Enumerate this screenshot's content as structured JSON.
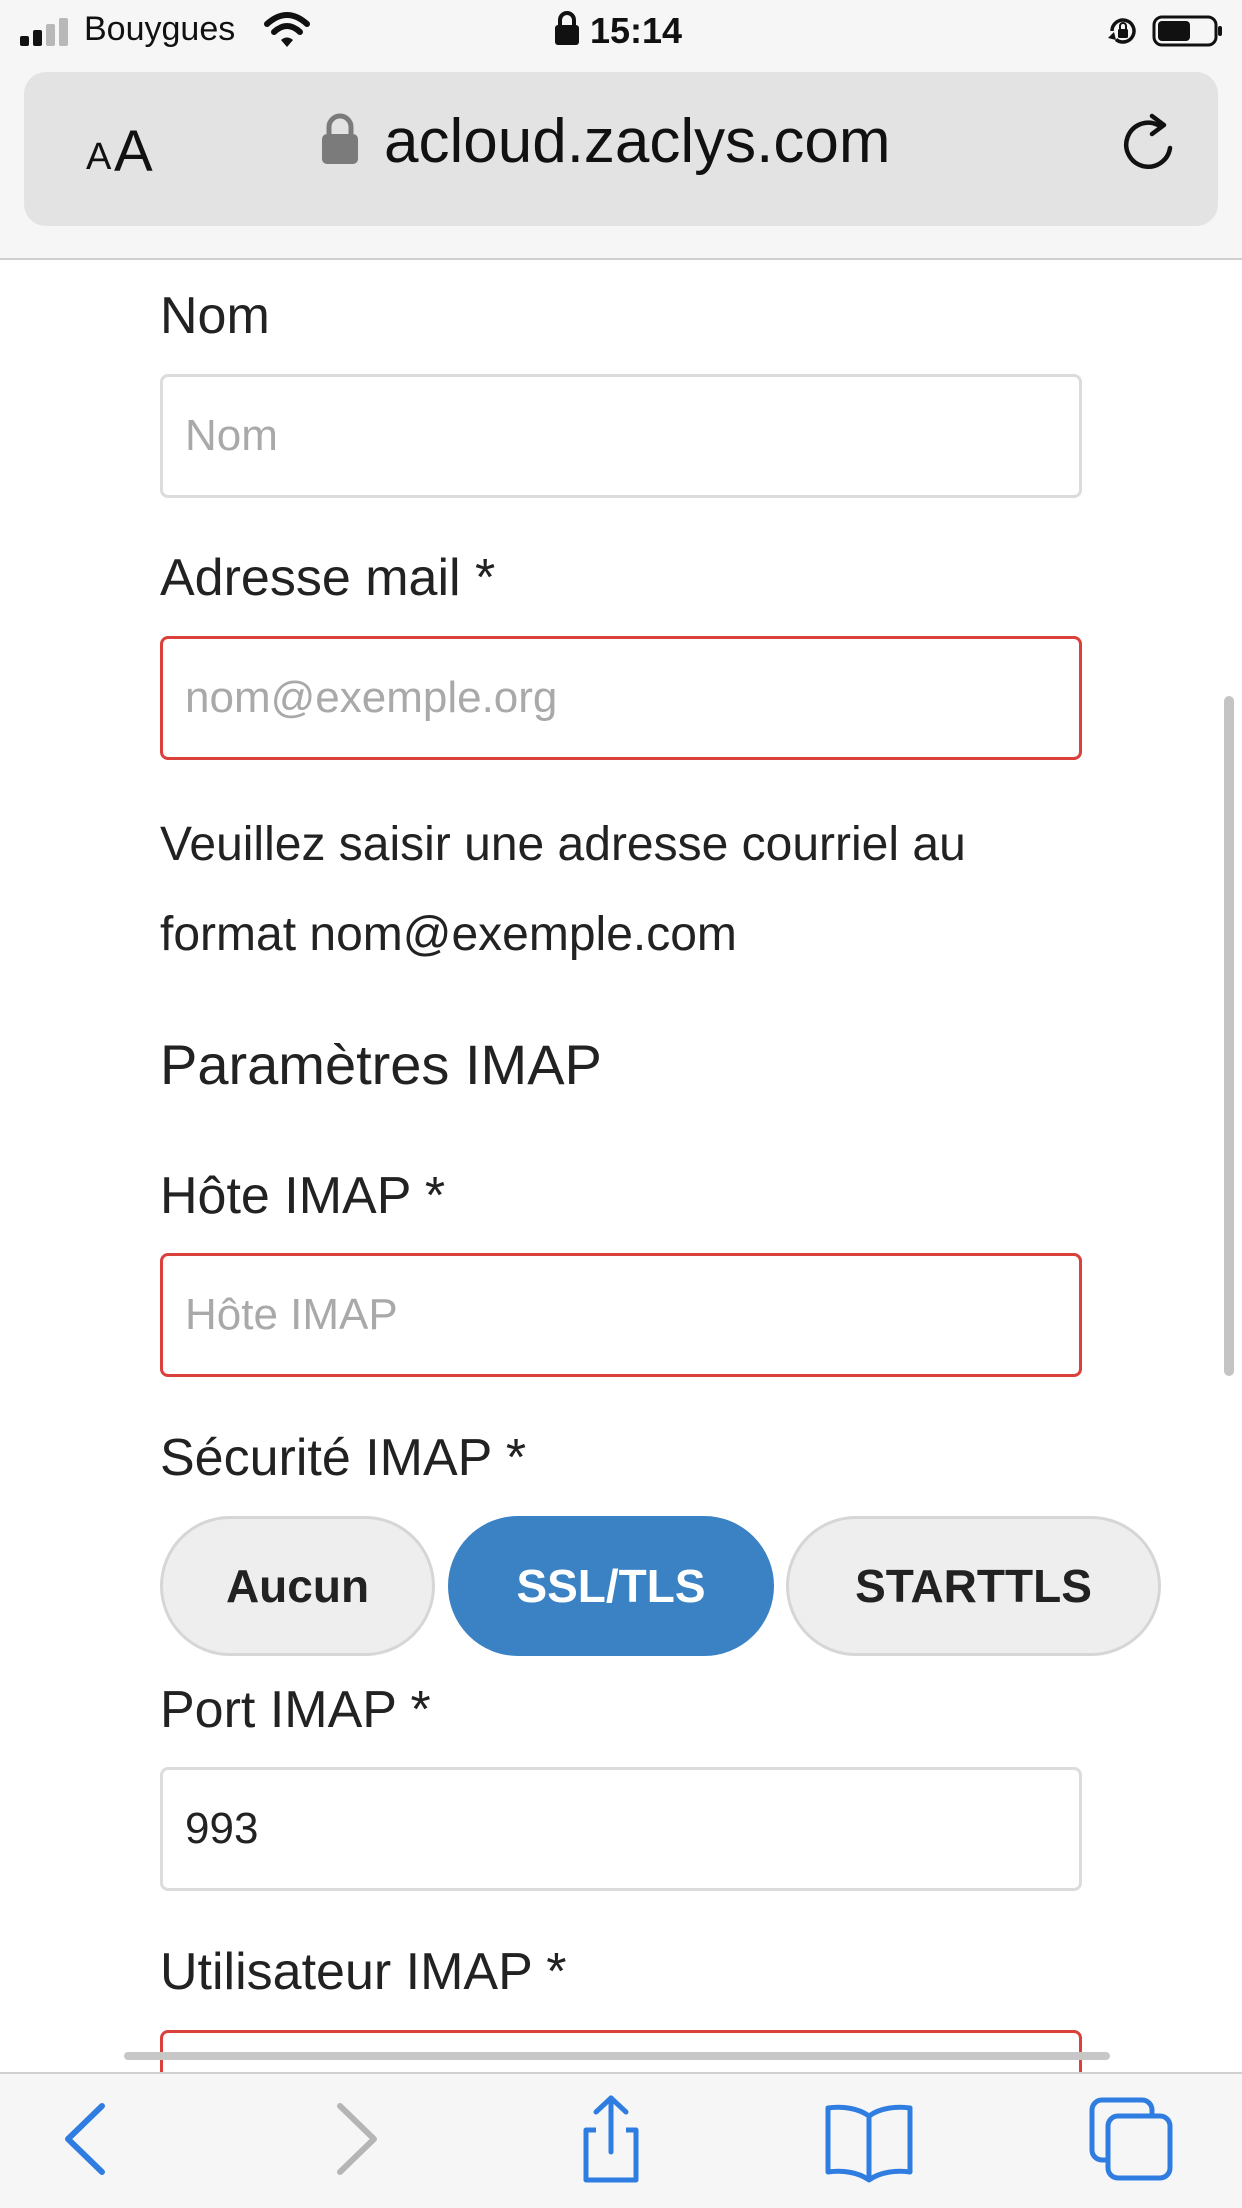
{
  "status_bar": {
    "carrier": "Bouygues",
    "time": "15:14",
    "battery_level": 0.6
  },
  "browser": {
    "text_size_small": "A",
    "text_size_large": "A",
    "url": "acloud.zaclys.com"
  },
  "form": {
    "nom": {
      "label": "Nom",
      "placeholder": "Nom",
      "value": ""
    },
    "email": {
      "label": "Adresse mail *",
      "placeholder": "nom@exemple.org",
      "value": "",
      "hint": "Veuillez saisir une adresse courriel au format nom@exemple.com"
    },
    "imap_section_title": "Paramètres IMAP",
    "imap_host": {
      "label": "Hôte IMAP *",
      "placeholder": "Hôte IMAP",
      "value": ""
    },
    "imap_security": {
      "label": "Sécurité IMAP *",
      "options": [
        "Aucun",
        "SSL/TLS",
        "STARTTLS"
      ],
      "selected": "SSL/TLS"
    },
    "imap_port": {
      "label": "Port IMAP *",
      "value": "993"
    },
    "imap_user": {
      "label": "Utilisateur IMAP *"
    }
  },
  "colors": {
    "accent": "#3b82c4",
    "error_border": "#d9413a",
    "nav_blue": "#2f7de1"
  },
  "bottom_nav": [
    "back-icon",
    "forward-icon",
    "share-icon",
    "bookmarks-icon",
    "tabs-icon"
  ]
}
